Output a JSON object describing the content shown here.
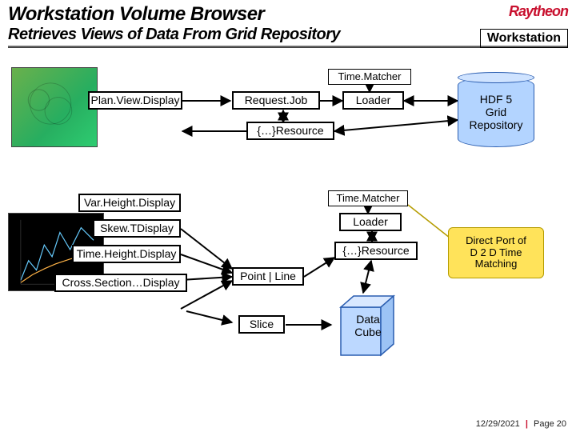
{
  "header": {
    "title": "Workstation Volume Browser",
    "subtitle": "Retrieves Views of Data From Grid Repository",
    "brand": "Raytheon",
    "badge": "Workstation"
  },
  "nodes": {
    "planview": "Plan.View.Display",
    "requestjob": "Request.Job",
    "timematcher1": "Time.Matcher",
    "loader1": "Loader",
    "resource1": "{…}Resource",
    "varheight": "Var.Height.Display",
    "skewt": "Skew.TDisplay",
    "timeheight": "Time.Height.Display",
    "crosssection": "Cross.Section…Display",
    "timematcher2": "Time.Matcher",
    "loader2": "Loader",
    "resource2": "{…}Resource",
    "pointline": "Point | Line",
    "slice": "Slice",
    "datacube": "Data\nCube",
    "hdf5": "HDF 5\nGrid\nRepository"
  },
  "callout": "Direct Port of\nD 2 D Time\nMatching",
  "footer": {
    "date": "12/29/2021",
    "page": "Page 20"
  }
}
